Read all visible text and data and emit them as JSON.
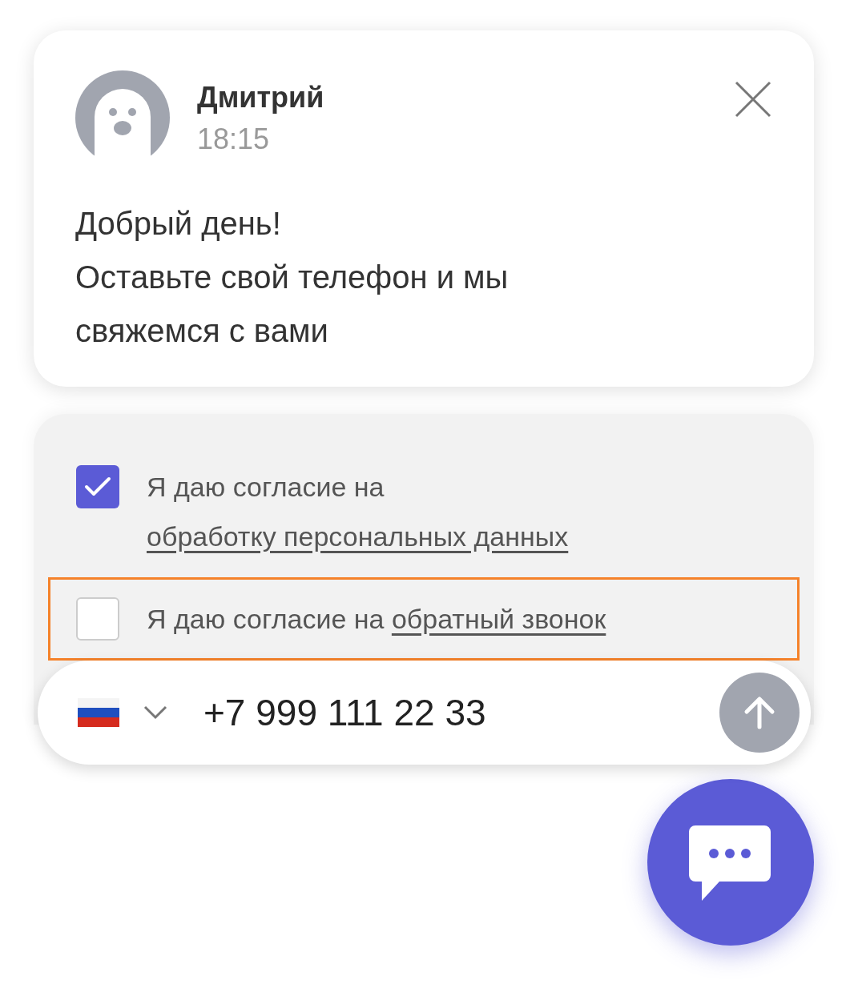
{
  "message": {
    "sender": "Дмитрий",
    "time": "18:15",
    "lines": [
      "Добрый день!",
      "Оставьте свой телефон и мы свяжемся с вами"
    ]
  },
  "consents": [
    {
      "text": "Я даю согласие на ",
      "link": "обработку персональных данных",
      "checked": true,
      "highlighted": false
    },
    {
      "text": "Я даю согласие на ",
      "link": "обратный звонок",
      "checked": false,
      "highlighted": true
    }
  ],
  "phone": {
    "value": "+7 999 111 22 33",
    "send_enabled": false
  },
  "chat_button": {
    "kind": "chat"
  }
}
